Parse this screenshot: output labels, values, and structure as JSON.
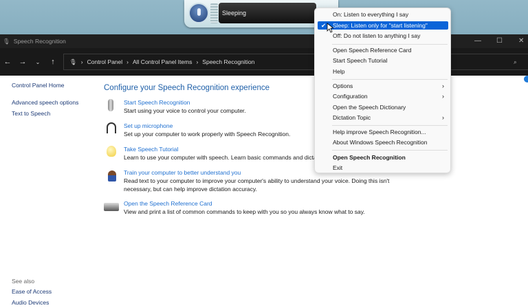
{
  "speech_bar": {
    "status": "Sleeping"
  },
  "window": {
    "title": "Speech Recognition",
    "breadcrumb": [
      "Control Panel",
      "All Control Panel Items",
      "Speech Recognition"
    ]
  },
  "sidebar": {
    "items": [
      "Control Panel Home",
      "Advanced speech options",
      "Text to Speech"
    ],
    "see_also_label": "See also",
    "see_also": [
      "Ease of Access",
      "Audio Devices"
    ]
  },
  "main": {
    "title": "Configure your Speech Recognition experience",
    "items": [
      {
        "link": "Start Speech Recognition",
        "desc": "Start using your voice to control your computer.",
        "icon": "microphone-icon"
      },
      {
        "link": "Set up microphone",
        "desc": "Set up your computer to work properly with Speech Recognition.",
        "icon": "headset-icon"
      },
      {
        "link": "Take Speech Tutorial",
        "desc": "Learn to use your computer with speech.  Learn basic commands and dictat",
        "icon": "lightbulb-icon"
      },
      {
        "link": "Train your computer to better understand you",
        "desc": "Read text to your computer to improve your computer's ability to understand your voice.  Doing this isn't necessary, but can help improve dictation accuracy.",
        "icon": "user-icon"
      },
      {
        "link": "Open the Speech Reference Card",
        "desc": "View and print a list of common commands to keep with you so you always know what to say.",
        "icon": "printer-icon"
      }
    ]
  },
  "menu": {
    "items": [
      {
        "label": "On: Listen to everything I say"
      },
      {
        "label": "Sleep: Listen only for \"start listening\"",
        "checked": true,
        "selected": true
      },
      {
        "label": "Off: Do not listen to anything I say"
      },
      {
        "label": "Open Speech Reference Card"
      },
      {
        "label": "Start Speech Tutorial"
      },
      {
        "label": "Help"
      },
      {
        "label": "Options",
        "submenu": true
      },
      {
        "label": "Configuration",
        "submenu": true
      },
      {
        "label": "Open the Speech Dictionary"
      },
      {
        "label": "Dictation Topic",
        "submenu": true
      },
      {
        "label": "Help improve Speech Recognition..."
      },
      {
        "label": "About Windows Speech Recognition"
      },
      {
        "label": "Open Speech Recognition",
        "bold": true
      },
      {
        "label": "Exit"
      }
    ]
  },
  "colors": {
    "accent": "#0a64d8",
    "link": "#1e6fd0",
    "heading": "#1e5fa8"
  }
}
